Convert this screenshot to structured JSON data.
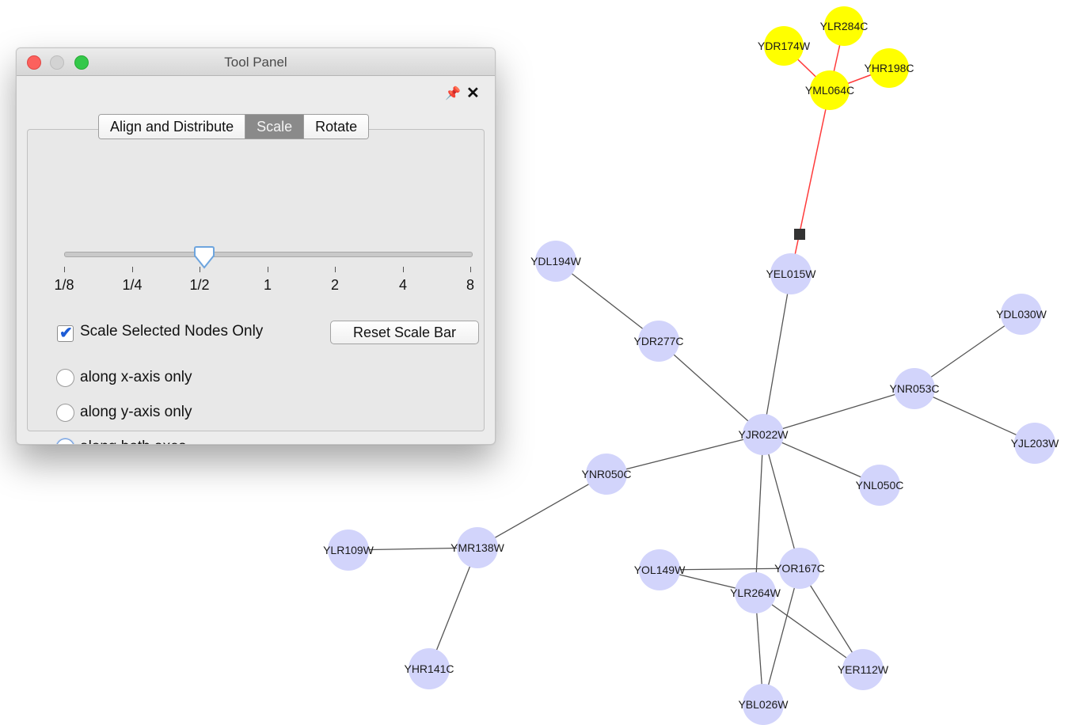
{
  "window": {
    "title": "Tool Panel",
    "tabs": [
      "Align and Distribute",
      "Scale",
      "Rotate"
    ],
    "active_tab": "Scale",
    "scale": {
      "slider_labels": [
        "1/8",
        "1/4",
        "1/2",
        "1",
        "2",
        "4",
        "8"
      ],
      "slider_value": "1/2",
      "checkbox_label": "Scale Selected Nodes Only",
      "checkbox_checked": true,
      "reset_button_label": "Reset Scale Bar",
      "radio_options": [
        "along x-axis only",
        "along y-axis only",
        "along both axes"
      ],
      "radio_selected": "along both axes"
    }
  },
  "network": {
    "colors": {
      "default_node": "#d2d4fb",
      "selected_node": "#ffff00",
      "edge": "#555555",
      "selected_edge": "#ff3b3b",
      "handle": "#333333"
    },
    "nodes": [
      {
        "id": "YLR284C",
        "selected": true
      },
      {
        "id": "YDR174W",
        "selected": true
      },
      {
        "id": "YHR198C",
        "selected": true
      },
      {
        "id": "YML064C",
        "selected": true
      },
      {
        "id": "YEL015W",
        "selected": false
      },
      {
        "id": "YDL194W",
        "selected": false
      },
      {
        "id": "YDR277C",
        "selected": false
      },
      {
        "id": "YDL030W",
        "selected": false
      },
      {
        "id": "YNR053C",
        "selected": false
      },
      {
        "id": "YJR022W",
        "selected": false
      },
      {
        "id": "YJL203W",
        "selected": false
      },
      {
        "id": "YNR050C",
        "selected": false
      },
      {
        "id": "YNL050C",
        "selected": false
      },
      {
        "id": "YLR109W",
        "selected": false
      },
      {
        "id": "YMR138W",
        "selected": false
      },
      {
        "id": "YOL149W",
        "selected": false
      },
      {
        "id": "YOR167C",
        "selected": false
      },
      {
        "id": "YLR264W",
        "selected": false
      },
      {
        "id": "YHR141C",
        "selected": false
      },
      {
        "id": "YER112W",
        "selected": false
      },
      {
        "id": "YBL026W",
        "selected": false
      }
    ],
    "edges": [
      [
        "YML064C",
        "YLR284C",
        true
      ],
      [
        "YML064C",
        "YDR174W",
        true
      ],
      [
        "YML064C",
        "YHR198C",
        true
      ],
      [
        "YML064C",
        "YEL015W",
        true
      ],
      [
        "YEL015W",
        "YJR022W",
        false
      ],
      [
        "YDL194W",
        "YDR277C",
        false
      ],
      [
        "YDR277C",
        "YJR022W",
        false
      ],
      [
        "YJR022W",
        "YNR053C",
        false
      ],
      [
        "YNR053C",
        "YDL030W",
        false
      ],
      [
        "YNR053C",
        "YJL203W",
        false
      ],
      [
        "YJR022W",
        "YNL050C",
        false
      ],
      [
        "YJR022W",
        "YNR050C",
        false
      ],
      [
        "YNR050C",
        "YMR138W",
        false
      ],
      [
        "YLR109W",
        "YMR138W",
        false
      ],
      [
        "YMR138W",
        "YHR141C",
        false
      ],
      [
        "YJR022W",
        "YOR167C",
        false
      ],
      [
        "YJR022W",
        "YLR264W",
        false
      ],
      [
        "YOL149W",
        "YOR167C",
        false
      ],
      [
        "YOL149W",
        "YLR264W",
        false
      ],
      [
        "YOR167C",
        "YER112W",
        false
      ],
      [
        "YOR167C",
        "YBL026W",
        false
      ],
      [
        "YLR264W",
        "YER112W",
        false
      ],
      [
        "YLR264W",
        "YBL026W",
        false
      ]
    ]
  }
}
